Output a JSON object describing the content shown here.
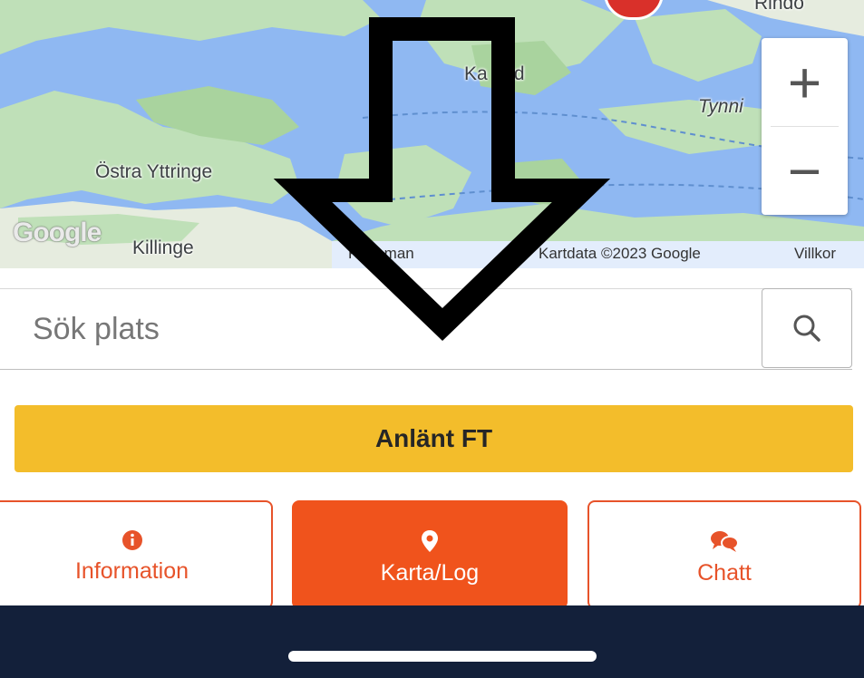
{
  "map": {
    "place_labels": {
      "ostra_yttringe": "Östra Yttringe",
      "killinge": "Killinge",
      "karludd": "Ka     udd",
      "tynni": "Tynni",
      "rindo": "Rindö"
    },
    "logo_text": "Google",
    "attribution": {
      "shortcuts": "Ko     mman",
      "map_data": "Kartdata ©2023 Google",
      "terms": "Villkor"
    },
    "zoom": {
      "in_label": "+",
      "out_label": "−"
    },
    "colors": {
      "water": "#8fb8f2",
      "land": "#bfe0b8",
      "land_light": "#e6ecdf"
    }
  },
  "overlay": {
    "arrow_icon": "down-arrow-outline",
    "arrow_color": "#000000"
  },
  "search": {
    "placeholder": "Sök plats",
    "value": "",
    "button_icon": "search-icon"
  },
  "primary_action": {
    "label": "Anlänt FT",
    "color": "#f3bd2b"
  },
  "tabs": [
    {
      "label": "Information",
      "icon": "info-circle-icon",
      "active": false
    },
    {
      "label": "Karta/Log",
      "icon": "map-pin-icon",
      "active": true
    },
    {
      "label": "Chatt",
      "icon": "chat-bubbles-icon",
      "active": false
    }
  ],
  "theme": {
    "accent": "#f0531c",
    "nav_bar": "#13203a"
  }
}
